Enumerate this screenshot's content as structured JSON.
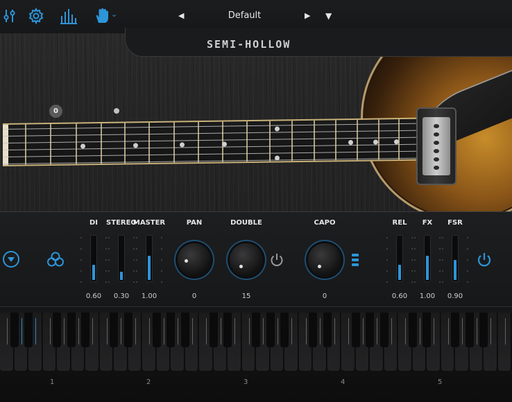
{
  "toolbar": {
    "icons": [
      "settings-sliders-icon",
      "gear-icon",
      "mixer-bars-icon",
      "hand-icon"
    ],
    "hand_menu_chevron": "⌄"
  },
  "preset": {
    "prev_arrow": "◀",
    "name": "Default",
    "next_arrow": "▶",
    "menu_arrow": "▼"
  },
  "product": {
    "logo_text": "SEMI-HOLLOW"
  },
  "fretboard": {
    "position_badge": "0",
    "fret_count": 16
  },
  "controls": {
    "faders": [
      {
        "label": "DI",
        "value": "0.60",
        "level": 0.35
      },
      {
        "label": "STEREO",
        "value": "0.30",
        "level": 0.18
      },
      {
        "label": "MASTER",
        "value": "1.00",
        "level": 0.55
      },
      {
        "label": "REL",
        "value": "0.60",
        "level": 0.35
      },
      {
        "label": "FX",
        "value": "1.00",
        "level": 0.55
      },
      {
        "label": "FSR",
        "value": "0.90",
        "level": 0.45
      }
    ],
    "knobs": [
      {
        "label": "PAN",
        "value": "0"
      },
      {
        "label": "DOUBLE",
        "value": "15"
      },
      {
        "label": "CAPO",
        "value": "0"
      }
    ]
  },
  "colors": {
    "accent": "#2d95d8",
    "background": "#111214",
    "panel": "#1b1c1e"
  },
  "keyboard": {
    "octave_labels": [
      "1",
      "2",
      "3",
      "4",
      "5"
    ]
  }
}
